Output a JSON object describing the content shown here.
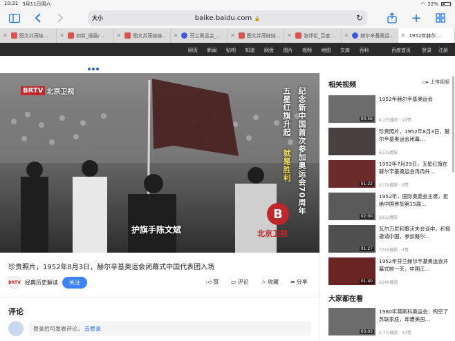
{
  "status": {
    "time": "10:31",
    "date": "3月11日周六",
    "battery": "22%"
  },
  "toolbar": {
    "text_size": "大小",
    "url": "baike.baidu.com",
    "lock": "🔒"
  },
  "tabs": [
    {
      "label": "图文并茂娃…",
      "fav": "red"
    },
    {
      "label": "如新_插画/…",
      "fav": "red"
    },
    {
      "label": "图文并茂娃娃…",
      "fav": "red"
    },
    {
      "label": "芬兰奥运会_…",
      "fav": "blue"
    },
    {
      "label": "图文并茂娃娃…",
      "fav": "red"
    },
    {
      "label": "张邦伦_百度…",
      "fav": "red"
    },
    {
      "label": "赫尔辛基奥运…",
      "fav": "blue"
    },
    {
      "label": "1952年赫尔…",
      "fav": "none",
      "active": true
    }
  ],
  "bnav": [
    "网页",
    "新闻",
    "贴吧",
    "知道",
    "网盘",
    "图片",
    "视频",
    "地图",
    "文库",
    "百科"
  ],
  "bnav_right": [
    "百度首页",
    "登录",
    "注册"
  ],
  "video": {
    "brtv": "BRTV",
    "channel": "北京卫视",
    "vtext1": "五星红旗升起",
    "vtext2": "就是胜利",
    "vtext3": "纪念新中国首次参加奥运会70周年",
    "caption": "护旗手陈文斌",
    "channel_logo": "B",
    "channel_label": "北京卫视"
  },
  "main": {
    "title": "珍贵照片，1952年8月3日，赫尔辛基奥运会闭幕式中国代表团入场",
    "author_avatar": "BRTV",
    "author": "经典历史解读",
    "follow": "关注",
    "like": "赞",
    "comment": "评论",
    "collect": "收藏",
    "share": "分享",
    "comments_heading": "评论",
    "comment_prompt": "登录后可发表评论，",
    "login_link": "去登录"
  },
  "sidebar": {
    "heading": "相关视频",
    "upload": "上传视频",
    "videos": [
      {
        "title": "1952年赫尔辛基奥运会",
        "meta": "4.2万播放 · 19赞",
        "duration": "00:56"
      },
      {
        "title": "珍贵照片，1952年8月3日，赫尔辛基奥运会闭幕…",
        "meta": "6131播放",
        "duration": ""
      },
      {
        "title": "1952年7月29日，五星红旗在赫尔辛基奥运会冉冉升…",
        "meta": "5174播放 · 5赞",
        "duration": "01:22"
      },
      {
        "title": "1952年，国际奥委会主席，拒绝中国参加第15届…",
        "meta": "8932播放",
        "duration": "02:00"
      },
      {
        "title": "瓦尔万尼和黎沃夫会谈中，积极邀请中国，参加赫尔…",
        "meta": "7733播放 · 3赞",
        "duration": "01:27"
      },
      {
        "title": "1952年芬兰赫尔辛基奥运会开幕式前一天，中国正…",
        "meta": "6240播放",
        "duration": "01:40"
      }
    ],
    "heading2": "大家都在看",
    "videos2": [
      {
        "title": "1980年莫斯科奥运会：掏空了苏联家底，却遭美国…",
        "meta": "2.7万播放 · 42赞",
        "duration": "03:03"
      }
    ]
  }
}
